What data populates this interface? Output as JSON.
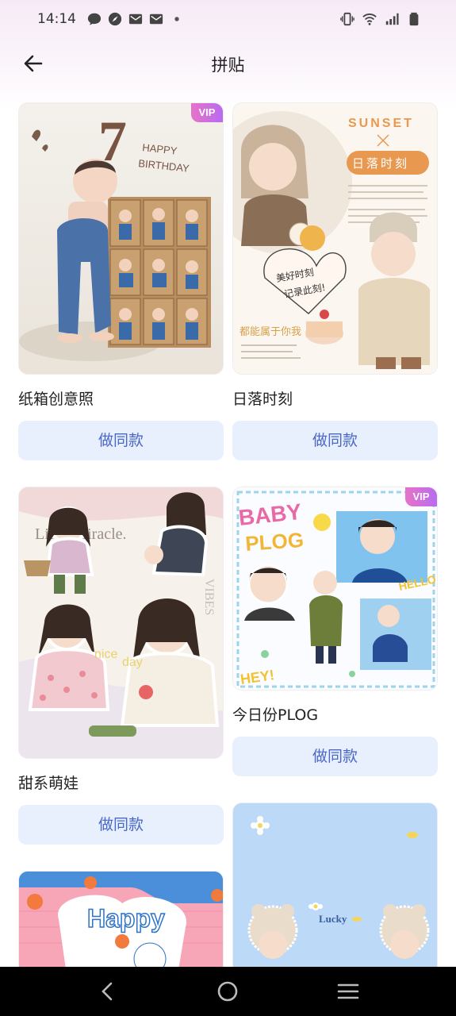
{
  "status_bar": {
    "time": "14:14",
    "left_icons": [
      "chat-icon",
      "compass-icon",
      "mail-icon",
      "mail-icon",
      "dot-icon"
    ],
    "right_icons": [
      "vibrate-icon",
      "wifi-icon",
      "signal-icon",
      "battery-icon"
    ]
  },
  "header": {
    "title": "拼贴"
  },
  "templates": [
    {
      "title": "纸箱创意照",
      "button": "做同款",
      "vip": true,
      "vip_label": "VIP",
      "image_text": [
        "7",
        "HAPPY",
        "BIRTHDAY"
      ]
    },
    {
      "title": "日落时刻",
      "button": "做同款",
      "vip": false,
      "image_text": [
        "SUNSET",
        "日落时刻",
        "都能属于你我",
        "美好时刻",
        "记录此刻!"
      ]
    },
    {
      "title": "甜系萌娃",
      "button": "做同款",
      "vip": false,
      "image_text": [
        "Little Miracle.",
        "nice",
        "day",
        "VIBES"
      ]
    },
    {
      "title": "今日份PLOG",
      "button": "做同款",
      "vip": true,
      "vip_label": "VIP",
      "image_text": [
        "BABY",
        "PLOG",
        "HELLO",
        "HEY!"
      ]
    },
    {
      "title": "",
      "button": "",
      "vip": false,
      "image_text": [
        "Happy"
      ]
    },
    {
      "title": "",
      "button": "",
      "vip": false,
      "image_text": [
        "Lucky"
      ]
    }
  ],
  "nav_bar": {
    "items": [
      "back-icon",
      "home-icon",
      "menu-icon"
    ]
  },
  "colors": {
    "button_bg": "#e8effd",
    "button_text": "#4a68c8",
    "vip_gradient_start": "#e772c8",
    "vip_gradient_end": "#b86cf0"
  }
}
